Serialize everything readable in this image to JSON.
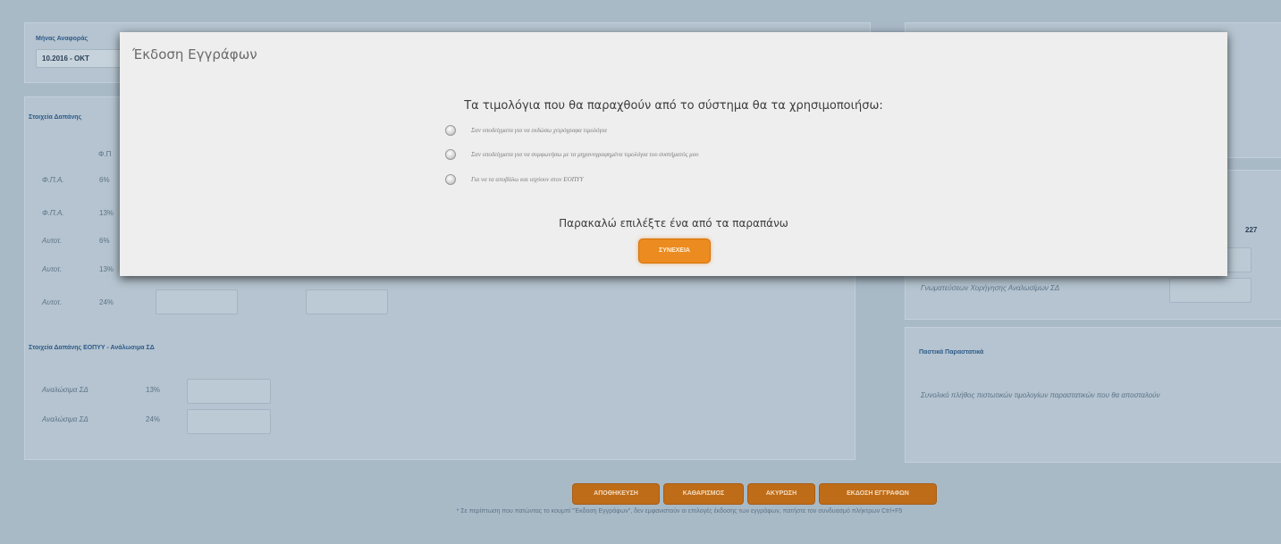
{
  "background": {
    "month_label": "Μήνας Αναφοράς",
    "month_value": "10.2016 - ΟΚΤ",
    "section1_title": "Στοιχεία Δαπάνης",
    "col_header": "Φ.Π",
    "rows": [
      {
        "label": "Φ.Π.Α.",
        "pct": "6%"
      },
      {
        "label": "Φ.Π.Α.",
        "pct": "13%"
      },
      {
        "label": "Αυτοτ.",
        "pct": "6%"
      },
      {
        "label": "Αυτοτ.",
        "pct": "13%"
      },
      {
        "label": "Αυτοτ.",
        "pct": "24%"
      }
    ],
    "section2_title": "Στοιχεία Δαπάνης ΕΟΠΥΥ - Ανάλωσιμα ΣΔ",
    "rows2": [
      {
        "label": "Αναλώσιμα ΣΔ",
        "pct": "13%"
      },
      {
        "label": "Αναλώσιμα ΣΔ",
        "pct": "24%"
      }
    ],
    "right_side_label": "Γνωματεύσεων Χορήγησης Αναλωσίμων ΣΔ",
    "right_code": "227",
    "right_section_title": "Παστικά Παραστατικά",
    "right_section_text": "Συνολικό πλήθος πιστωτικών τιμολογίων παραστατικών που θα αποσταλούν"
  },
  "buttons": {
    "save": "ΑΠΟΘΗΚΕΥΣΗ",
    "clear": "ΚΑΘΑΡΙΣΜΟΣ",
    "cancel": "ΑΚΥΡΩΣΗ",
    "issue": "ΕΚΔΟΣΗ ΕΓΓΡΑΦΩΝ"
  },
  "footer_note": "* Σε περίπτωση που πατώντας το κουμπί \"Έκδοση Εγγράφων\", δεν εμφανιστούν οι επιλογές έκδοσης των εγγράφων, πατήστε τον συνδυασμό πλήκτρων Ctrl+F5",
  "modal": {
    "title": "Έκδοση Εγγράφων",
    "question": "Τα τιμολόγια που θα παραχθούν από το σύστημα θα τα χρησιμοποιήσω:",
    "options": [
      "Σαν υποδείγματα για να εκδώσω χειρόγραφα τιμολόγια",
      "Σαν υποδείγματα για να συμφωνήσω με τα μηχανογραφημένα τιμολόγια του συστήματός μου",
      "Για να τα αποβάλω και ισχύουν στον ΕΟΠΥΥ"
    ],
    "prompt": "Παρακαλώ επιλέξτε ένα από τα παραπάνω",
    "continue": "ΣΥΝΕΧΕΙΑ"
  }
}
